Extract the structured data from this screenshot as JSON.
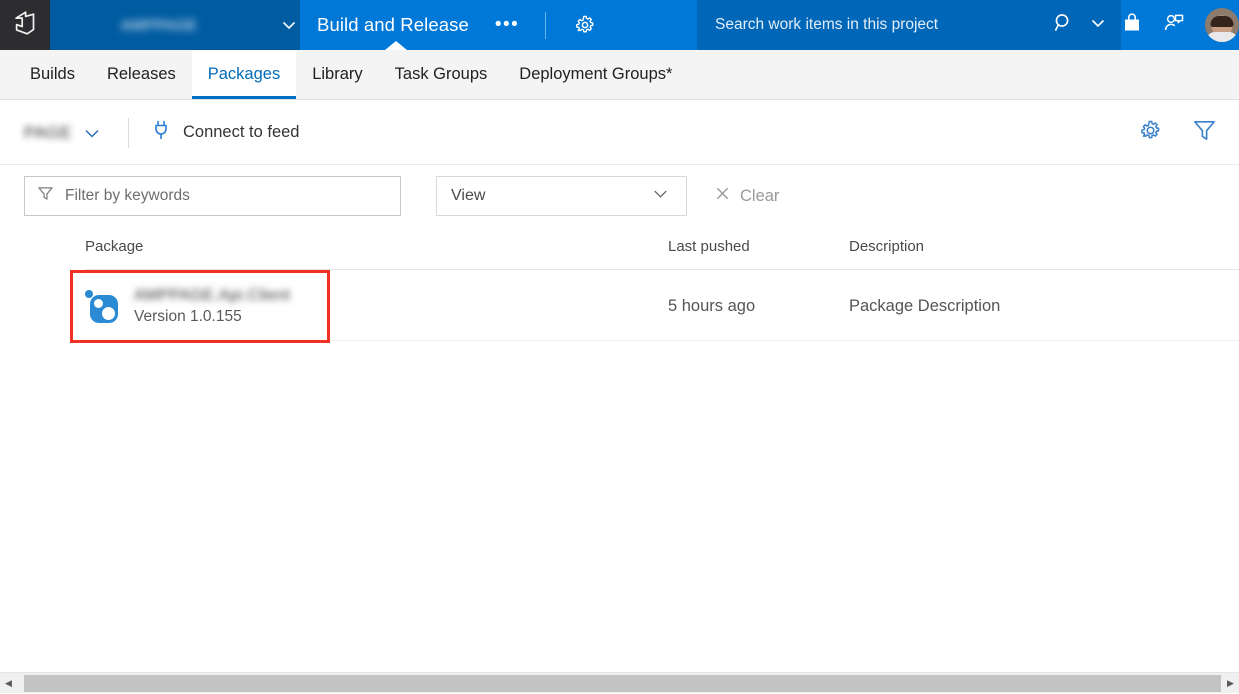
{
  "header": {
    "logo_icon": "azure-devops-logo-icon",
    "project_name": "AMPPAGE",
    "project_chevron_icon": "chevron-down-icon",
    "hub_title": "Build and Release",
    "hub_more_label": "•••",
    "hub_settings_icon": "gear-icon",
    "search_placeholder": "Search work items in this project",
    "search_icon": "search-icon",
    "search_chevron_icon": "chevron-down-icon",
    "marketplace_icon": "shopping-bag-icon",
    "invite_icon": "add-user-icon",
    "avatar_icon": "user-avatar"
  },
  "tabs": [
    {
      "label": "Builds",
      "active": false
    },
    {
      "label": "Releases",
      "active": false
    },
    {
      "label": "Packages",
      "active": true
    },
    {
      "label": "Library",
      "active": false
    },
    {
      "label": "Task Groups",
      "active": false
    },
    {
      "label": "Deployment Groups*",
      "active": false
    }
  ],
  "feedbar": {
    "feed_name": "PAGE",
    "feed_chevron_icon": "chevron-down-icon",
    "connect_label": "Connect to feed",
    "connect_icon": "plug-icon",
    "settings_icon": "gear-icon",
    "filter_icon": "funnel-icon"
  },
  "filters": {
    "keyword_placeholder": "Filter by keywords",
    "keyword_value": "",
    "keyword_icon": "funnel-icon",
    "view_value": "View",
    "view_chevron_icon": "chevron-down-icon",
    "clear_label": "Clear",
    "clear_icon": "close-icon"
  },
  "table": {
    "columns": [
      "Package",
      "Last pushed",
      "Description"
    ],
    "rows": [
      {
        "package_name": "AMPPAGE.Api.Client",
        "version": "Version 1.0.155",
        "icon": "nuget-package-icon",
        "last_pushed": "5 hours ago",
        "description": "Package Description"
      }
    ]
  },
  "scrollbar": {
    "left_arrow_icon": "chevron-left-icon",
    "right_arrow_icon": "chevron-right-icon"
  },
  "colors": {
    "header_dark": "#2d2d30",
    "header_blue_dark": "#005ba1",
    "header_blue": "#0078d7",
    "header_blue_search": "#0067b8",
    "accent_blue": "#0072c6",
    "link_blue": "#006bb7",
    "highlight_red": "#ef3124",
    "package_icon_blue": "#2a8ad4"
  }
}
